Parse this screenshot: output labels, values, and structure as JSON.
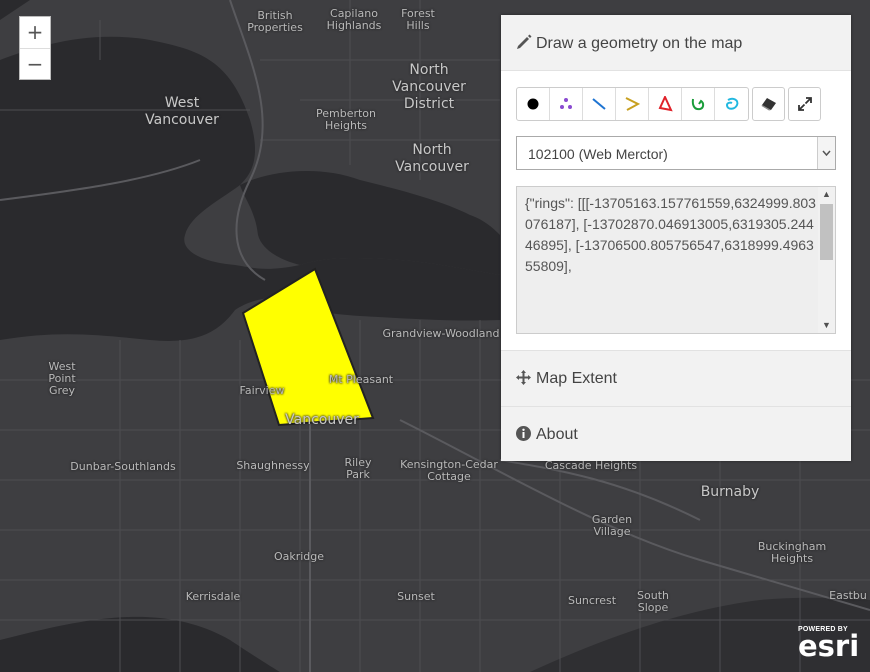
{
  "panel": {
    "title": "Draw a geometry on the map",
    "tools": [
      {
        "name": "point-tool",
        "icon": "point-icon",
        "color": "#000000"
      },
      {
        "name": "multipoint-tool",
        "icon": "multipoint-icon",
        "color": "#8a4bd1"
      },
      {
        "name": "line-tool",
        "icon": "line-icon",
        "color": "#1e74d2"
      },
      {
        "name": "polyline-tool",
        "icon": "polyline-icon",
        "color": "#c8a020"
      },
      {
        "name": "polygon-tool",
        "icon": "polygon-icon",
        "color": "#e0222a"
      },
      {
        "name": "freehand-polygon-tool",
        "icon": "freehand-polygon-icon",
        "color": "#1a9d3a"
      },
      {
        "name": "circle-tool",
        "icon": "circle-icon",
        "color": "#22b8e0"
      }
    ],
    "spatial_reference": "102100 (Web Merctor)",
    "geometry_json": "{\"rings\": [[[-13705163.157761559,6324999.803076187], [-13702870.046913005,6319305.24446895], [-13706500.805756547,6318999.496355809],",
    "sections": {
      "map_extent": "Map Extent",
      "about": "About"
    }
  },
  "zoom": {
    "in_label": "+",
    "out_label": "−"
  },
  "attribution": {
    "powered": "POWERED BY",
    "logo": "esri"
  },
  "map": {
    "colors": {
      "water": "#2a2a2d",
      "land": "#3e3e41",
      "roads": "#56565a",
      "drawn_polygon": "#ffff00"
    },
    "labels": [
      {
        "text": "British\nProperties",
        "cls": ""
      },
      {
        "text": "Capilano\nHighlands",
        "cls": ""
      },
      {
        "text": "Forest\nHills",
        "cls": ""
      },
      {
        "text": "North\nVancouver\nDistrict",
        "cls": "big"
      },
      {
        "text": "West\nVancouver",
        "cls": "big"
      },
      {
        "text": "Pemberton\nHeights",
        "cls": ""
      },
      {
        "text": "North\nVancouver",
        "cls": "big"
      },
      {
        "text": "Grandview-Woodland",
        "cls": ""
      },
      {
        "text": "West\nPoint\nGrey",
        "cls": ""
      },
      {
        "text": "Fairview",
        "cls": ""
      },
      {
        "text": "Mt Pleasant",
        "cls": ""
      },
      {
        "text": "Vancouver",
        "cls": "big"
      },
      {
        "text": "Dunbar-Southlands",
        "cls": ""
      },
      {
        "text": "Shaughnessy",
        "cls": ""
      },
      {
        "text": "Riley\nPark",
        "cls": ""
      },
      {
        "text": "Kensington-Cedar\nCottage",
        "cls": ""
      },
      {
        "text": "Cascade Heights",
        "cls": ""
      },
      {
        "text": "Burnaby",
        "cls": "big"
      },
      {
        "text": "Garden\nVillage",
        "cls": ""
      },
      {
        "text": "Buckingham\nHeights",
        "cls": ""
      },
      {
        "text": "Oakridge",
        "cls": ""
      },
      {
        "text": "Kerrisdale",
        "cls": ""
      },
      {
        "text": "Sunset",
        "cls": ""
      },
      {
        "text": "Suncrest",
        "cls": ""
      },
      {
        "text": "South\nSlope",
        "cls": ""
      },
      {
        "text": "Eastbu",
        "cls": ""
      }
    ]
  }
}
